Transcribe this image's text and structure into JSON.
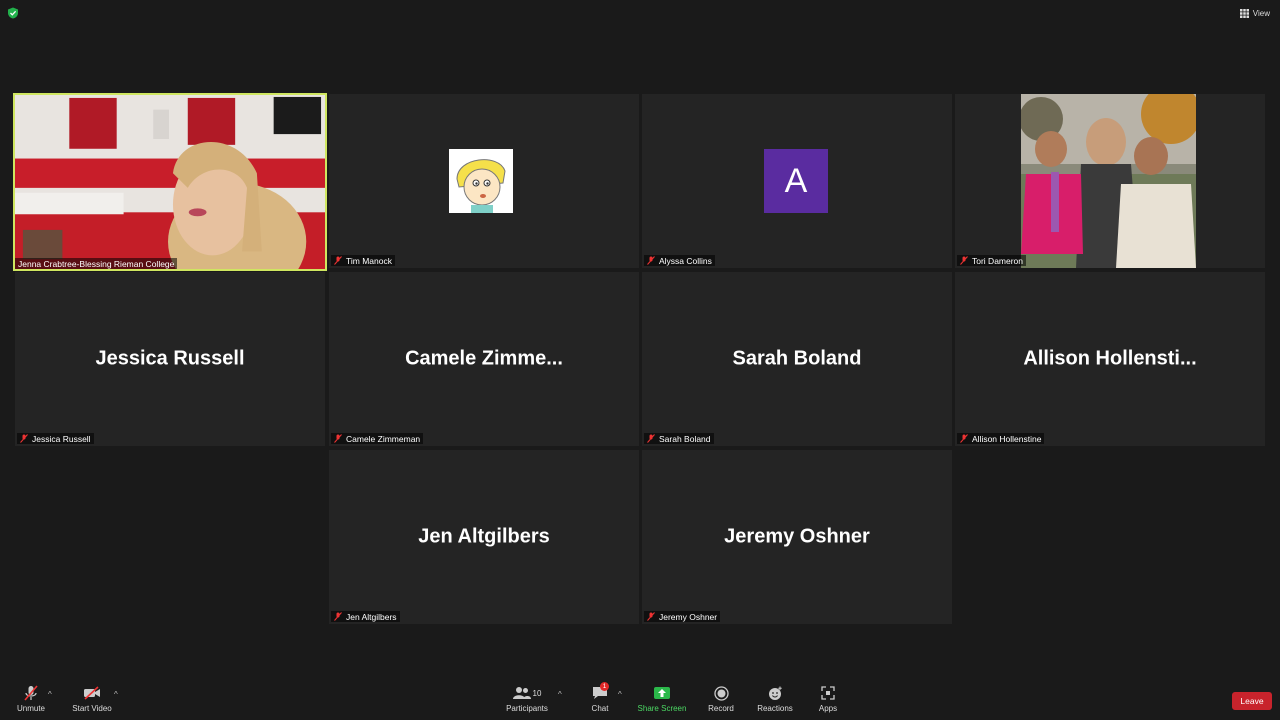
{
  "top_bar": {
    "view_label": "View"
  },
  "tiles": [
    {
      "name": "Jenna Crabtree-Blessing Rieman College",
      "center": ""
    },
    {
      "name": "Tim Manock",
      "center": ""
    },
    {
      "name": "Alyssa Collins",
      "center": "A"
    },
    {
      "name": "Tori Dameron",
      "center": ""
    },
    {
      "name": "Jessica Russell",
      "center": "Jessica Russell"
    },
    {
      "name": "Camele Zimmeman",
      "center": "Camele  Zimme..."
    },
    {
      "name": "Sarah Boland",
      "center": "Sarah Boland"
    },
    {
      "name": "Allison Hollenstine",
      "center": "Allison  Hollensti..."
    },
    {
      "name": "Jen Altgilbers",
      "center": "Jen Altgilbers"
    },
    {
      "name": "Jeremy Oshner",
      "center": "Jeremy Oshner"
    }
  ],
  "toolbar": {
    "unmute": "Unmute",
    "start_video": "Start Video",
    "participants": "Participants",
    "participants_count": "10",
    "chat": "Chat",
    "chat_badge": "1",
    "share_screen": "Share Screen",
    "record": "Record",
    "reactions": "Reactions",
    "apps": "Apps",
    "leave": "Leave"
  },
  "colors": {
    "active_border": "#cfe660",
    "avatar_purple": "#5a2ca0",
    "share_green": "#4cd964",
    "leave_red": "#c8232c"
  },
  "icons": [
    "shield-icon",
    "grid-icon",
    "mic-muted-icon",
    "video-off-icon",
    "participants-icon",
    "chat-icon",
    "share-screen-icon",
    "record-icon",
    "reactions-icon",
    "apps-icon"
  ]
}
